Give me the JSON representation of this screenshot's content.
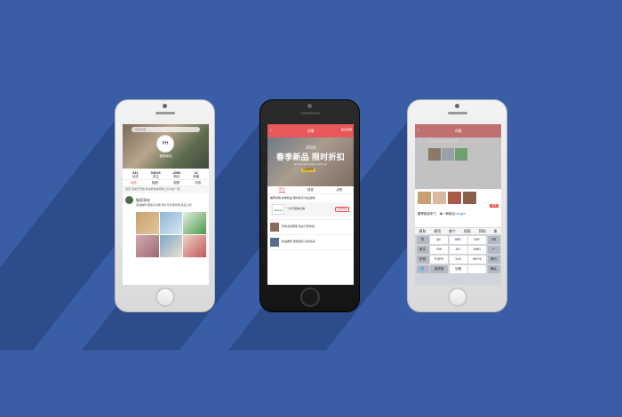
{
  "background_color": "#3a5ea6",
  "phone1": {
    "search_placeholder": "搜索内容",
    "avatar_logo": "PH",
    "profile_name": "猫家驿站",
    "stats": [
      {
        "value": "441",
        "label": "动态"
      },
      {
        "value": "54026",
        "label": "关注"
      },
      {
        "value": "4396",
        "label": "粉丝"
      },
      {
        "value": "12",
        "label": "收藏"
      }
    ],
    "tabs": [
      "动态",
      "相册",
      "视频",
      "问答"
    ],
    "notice": "置顶 活动已开始 欢迎参加本周线上分享会一起",
    "post_author": "猫家驿站",
    "post_text": "真诚推荐 居民好邻居 用户可享受优惠 新品上架"
  },
  "phone2": {
    "nav_title": "详情",
    "nav_right": "联系客服",
    "banner_year": "2018",
    "banner_title": "春季新品 限时折扣",
    "banner_sub": "spring new arrivals discount",
    "banner_badge": "立即抢购",
    "tabs": [
      "评论",
      "转发",
      "点赞"
    ],
    "item1_text": "推荐好物 春季新品 限时折扣 欢迎选购",
    "card_logo": "Oricol",
    "card_text": "一份不错的礼物",
    "card_button": "立即购买",
    "item2_text": "周末活动预告 欢迎大家参加",
    "item3_text": "新品推荐 限量发售 先到先得"
  },
  "phone3": {
    "nav_title": "详情",
    "body_text": "分享一下最近的收获 感谢大家支持",
    "send_label": "发送",
    "input_text": "春季新品来了，每一种组合",
    "input_highlight": "xiangfei",
    "candidates": [
      "想和",
      "想用",
      "像个",
      "相框",
      "拜和",
      "像"
    ],
    "keys": [
      "符",
      "@/.",
      "ABC",
      "DEF",
      "⌫",
      "英文",
      "GHI",
      "JKL",
      "MNO",
      "^^",
      "拼音",
      "PQRS",
      "TUV",
      "WXYZ",
      "换行",
      "🌐",
      "选拼音",
      "空格",
      "",
      "确认"
    ]
  }
}
